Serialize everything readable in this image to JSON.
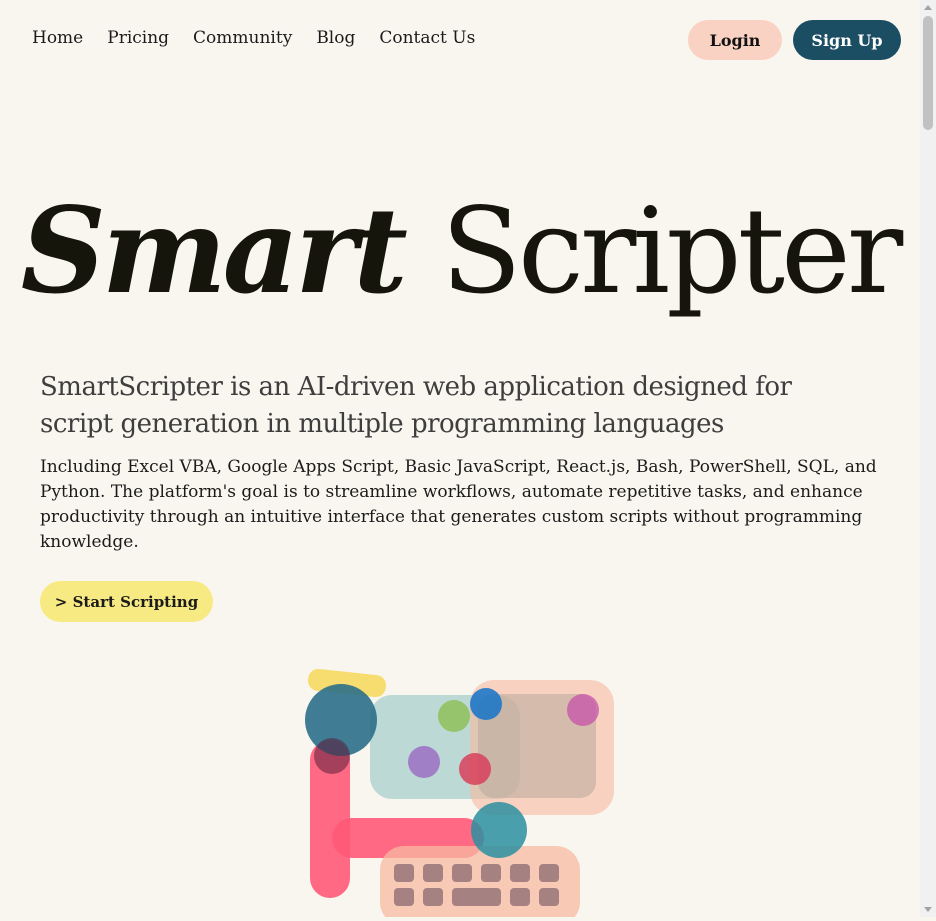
{
  "nav": {
    "links": [
      "Home",
      "Pricing",
      "Community",
      "Blog",
      "Contact Us"
    ],
    "login_label": "Login",
    "signup_label": "Sign Up"
  },
  "hero": {
    "title_italic": "Smart",
    "title_regular": "Scripter",
    "headline": "SmartScripter is an AI-driven web application designed for script generation in multiple programming languages",
    "description": "Including Excel VBA, Google Apps Script, Basic JavaScript, React.js, Bash, PowerShell, SQL, and Python. The platform's goal is to streamline workflows, automate repetitive tasks, and enhance productivity through an intuitive interface that generates custom scripts without programming knowledge.",
    "cta_label": "> Start Scripting"
  },
  "colors": {
    "background": "#f9f6ef",
    "login_bg": "#f9d2c3",
    "signup_bg": "#1c4e63",
    "cta_bg": "#f7ea83"
  },
  "icons": {
    "illustration": "abstract-computer-illustration-icon"
  }
}
